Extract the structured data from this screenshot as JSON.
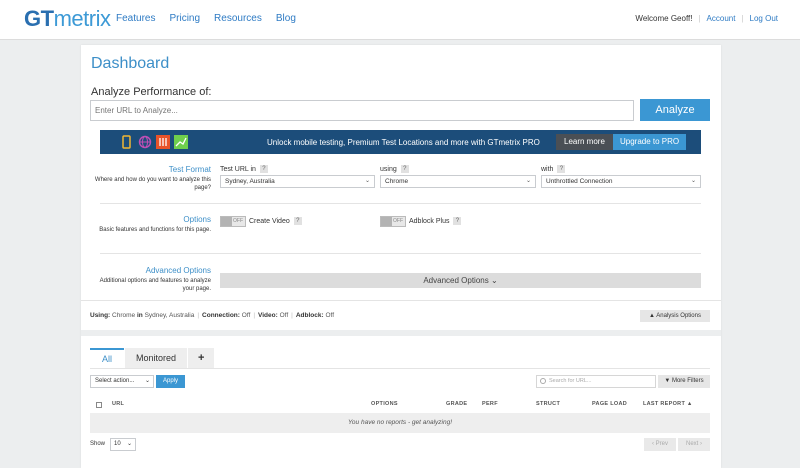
{
  "header": {
    "logo_gt": "GT",
    "logo_rest": "metrix",
    "nav": [
      "Features",
      "Pricing",
      "Resources",
      "Blog"
    ],
    "welcome": "Welcome Geoff!",
    "account": "Account",
    "logout": "Log Out"
  },
  "dashboard": {
    "title": "Dashboard",
    "subtitle": "Analyze Performance of:",
    "url_placeholder": "Enter URL to Analyze...",
    "analyze_label": "Analyze"
  },
  "promo": {
    "text": "Unlock mobile testing, Premium Test Locations and more with GTmetrix PRO",
    "learn_more": "Learn more",
    "upgrade": "Upgrade to PRO",
    "icon_colors": [
      "#f2b632",
      "#c14fb6",
      "#e8532a",
      "#6fcf4d"
    ]
  },
  "test_format": {
    "title": "Test Format",
    "desc": "Where and how do you want to analyze this page?",
    "test_url_in_label": "Test URL in",
    "location": "Sydney, Australia",
    "using_label": "using",
    "browser": "Chrome",
    "with_label": "with",
    "connection": "Unthrottled Connection"
  },
  "options": {
    "title": "Options",
    "desc": "Basic features and functions for this page.",
    "create_video": "Create Video",
    "adblock": "Adblock Plus",
    "toggle_off": "OFF"
  },
  "advanced": {
    "title": "Advanced Options",
    "desc": "Additional options and features to analyze your page.",
    "bar_label": "Advanced Options ⌄"
  },
  "using_summary": {
    "using_label": "Using:",
    "browser": "Chrome",
    "in_label": "in",
    "location": "Sydney, Australia",
    "connection_label": "Connection:",
    "connection": "Off",
    "video_label": "Video:",
    "video": "Off",
    "adblock_label": "Adblock:",
    "adblock": "Off",
    "analysis_options": "▲ Analysis Options"
  },
  "reports": {
    "tabs": [
      "All",
      "Monitored",
      "+"
    ],
    "select_action": "Select action...",
    "apply": "Apply",
    "search_placeholder": "Search for URL...",
    "more_filters": "▼ More Filters",
    "columns": [
      "URL",
      "OPTIONS",
      "GRADE",
      "PERF",
      "STRUCT",
      "PAGE LOAD",
      "LAST REPORT ▲"
    ],
    "empty_text": "You have no reports - get analyzing!",
    "show_label": "Show",
    "show_value": "10",
    "prev": "‹ Prev",
    "next": "Next ›"
  },
  "accent_color": "#3b97d3"
}
